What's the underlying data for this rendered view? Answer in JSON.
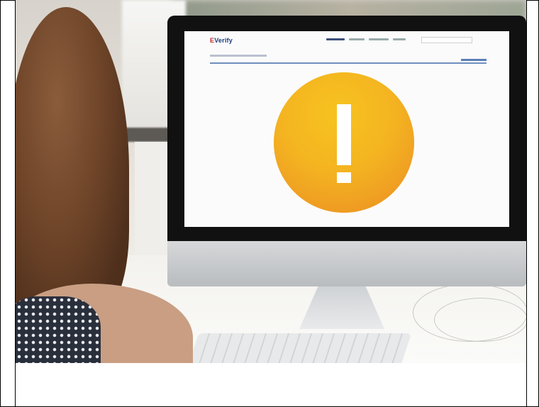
{
  "screen": {
    "logo_mark": "E",
    "logo_text": "Verify"
  },
  "icons": [
    "warning-exclamation-icon"
  ],
  "colors": {
    "warning_circle": "#f4b421",
    "logo_text": "#1b3b7a",
    "logo_mark": "#c62828"
  }
}
